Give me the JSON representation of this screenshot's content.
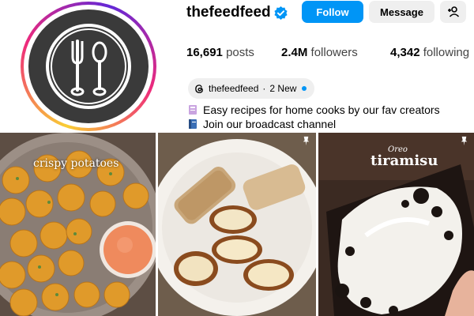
{
  "profile": {
    "username": "thefeedfeed",
    "verified": true,
    "avatar_icon": "fork-knife-logo-icon"
  },
  "actions": {
    "follow_label": "Follow",
    "message_label": "Message",
    "add_user_icon": "person-plus-icon"
  },
  "stats": {
    "posts_count": "16,691",
    "posts_label": "posts",
    "followers_count": "2.4M",
    "followers_label": "followers",
    "following_count": "4,342",
    "following_label": "following"
  },
  "threads": {
    "handle": "thefeedfeed",
    "separator": "·",
    "new_label": "2 New"
  },
  "bio": {
    "line1": "Easy recipes for home cooks by our fav creators",
    "line2": "Join our broadcast channel"
  },
  "posts": [
    {
      "caption": "crispy potatoes",
      "pinned": false
    },
    {
      "caption": "",
      "pinned": true
    },
    {
      "caption_top": "Oreo",
      "caption_main": "tiramisu",
      "pinned": true
    }
  ],
  "colors": {
    "accent": "#0095f6",
    "secondary_button": "#efefef"
  }
}
